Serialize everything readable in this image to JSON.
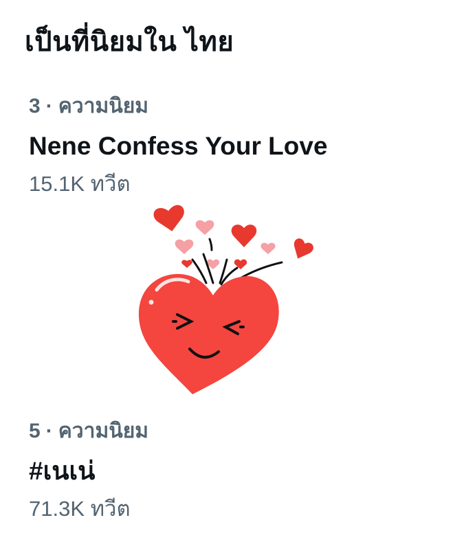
{
  "header": {
    "title": "เป็นที่นิยมใน ไทย"
  },
  "trends": [
    {
      "rank": "3",
      "separator": "·",
      "category": "ความนิยม",
      "name": "Nene Confess Your Love",
      "count": "15.1K ทวีต"
    },
    {
      "rank": "5",
      "separator": "·",
      "category": "ความนิยม",
      "name": "#เนเน่",
      "count": "71.3K ทวีต"
    }
  ],
  "illustration": {
    "icon": "heart-face-icon",
    "colors": {
      "heart": "#f4453f",
      "small_heart": "#e8392f",
      "pink_heart": "#f5a0a4",
      "lines": "#111111"
    }
  }
}
